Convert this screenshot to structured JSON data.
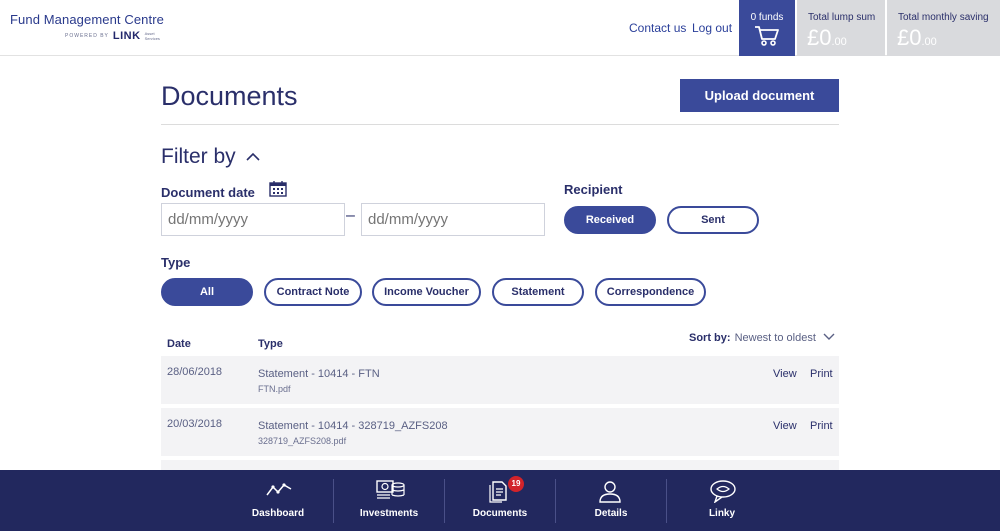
{
  "header": {
    "brand_title": "Fund Management Centre",
    "powered_by": "POWERED BY",
    "link_logo": "LINK",
    "link_small": "Asset Services",
    "contact_label": "Contact us",
    "logout_label": "Log out",
    "cart_label": "0 funds",
    "lump_sum_label": "Total lump sum",
    "lump_sum_value": "£0",
    "lump_sum_decimals": ".00",
    "monthly_label": "Total monthly saving",
    "monthly_value": "£0",
    "monthly_decimals": ".00"
  },
  "main": {
    "title": "Documents",
    "upload_label": "Upload document",
    "filter_label": "Filter by",
    "document_date_label": "Document date",
    "date_from_placeholder": "dd/mm/yyyy",
    "date_to_placeholder": "dd/mm/yyyy",
    "date_dash": "–",
    "recipient_label": "Recipient",
    "recipient_options": [
      "Received",
      "Sent"
    ],
    "type_label": "Type",
    "type_options": [
      "All",
      "Contract Note",
      "Income Voucher",
      "Statement",
      "Correspondence"
    ]
  },
  "table": {
    "col_date": "Date",
    "col_type": "Type",
    "sort_label": "Sort by:",
    "sort_value": "Newest to oldest",
    "rows": [
      {
        "date": "28/06/2018",
        "type": "Statement - 10414 - FTN",
        "file": "FTN.pdf",
        "view": "View",
        "print": "Print"
      },
      {
        "date": "20/03/2018",
        "type": "Statement - 10414 - 328719_AZFS208",
        "file": "328719_AZFS208.pdf",
        "view": "View",
        "print": "Print"
      }
    ]
  },
  "bottom_nav": {
    "items": [
      {
        "label": "Dashboard",
        "icon": "dashboard-icon"
      },
      {
        "label": "Investments",
        "icon": "investments-icon"
      },
      {
        "label": "Documents",
        "icon": "documents-icon",
        "badge": "19"
      },
      {
        "label": "Details",
        "icon": "person-icon"
      },
      {
        "label": "Linky",
        "icon": "chat-bot-icon"
      }
    ]
  },
  "colors": {
    "primary": "#3a4a9a",
    "navy": "#22285e",
    "summary_bg": "#d9dadd",
    "badge": "#d2232a"
  }
}
